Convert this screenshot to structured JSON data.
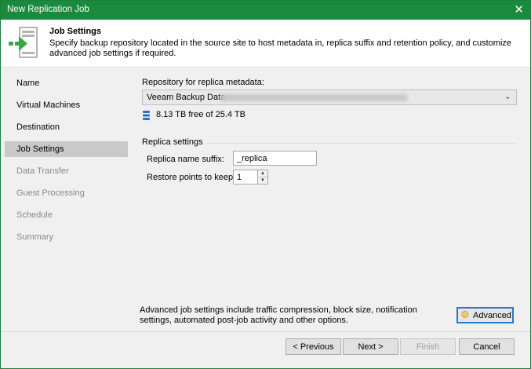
{
  "window": {
    "title": "New Replication Job",
    "close_glyph": "✕"
  },
  "header": {
    "title": "Job Settings",
    "description": "Specify backup repository located in the source site to host metadata in, replica suffix and retention policy, and customize advanced job settings if required.",
    "icon": "server-arrow-icon"
  },
  "sidebar": {
    "items": [
      {
        "label": "Name",
        "state": "normal"
      },
      {
        "label": "Virtual Machines",
        "state": "normal"
      },
      {
        "label": "Destination",
        "state": "normal"
      },
      {
        "label": "Job Settings",
        "state": "active"
      },
      {
        "label": "Data Transfer",
        "state": "disabled"
      },
      {
        "label": "Guest Processing",
        "state": "disabled"
      },
      {
        "label": "Schedule",
        "state": "disabled"
      },
      {
        "label": "Summary",
        "state": "disabled"
      }
    ]
  },
  "repository": {
    "label": "Repository for replica metadata:",
    "selected": "Veeam Backup Data",
    "free_space": "8.13 TB free of 25.4 TB"
  },
  "replica_settings": {
    "group_title": "Replica settings",
    "suffix_label": "Replica name suffix:",
    "suffix_value": "_replica",
    "restore_label": "Restore points to keep:",
    "restore_value": "1"
  },
  "advanced": {
    "text": "Advanced job settings include traffic compression, block size, notification settings, automated post-job activity and other options.",
    "button_label": "Advanced"
  },
  "footer": {
    "previous_label": "< Previous",
    "next_label": "Next >",
    "finish_label": "Finish",
    "cancel_label": "Cancel"
  },
  "colors": {
    "titlebar": "#1a8a3e",
    "active_nav": "#c9c9c9",
    "focus_border": "#2a78c8",
    "disk_icon": "#2f6fc2"
  }
}
